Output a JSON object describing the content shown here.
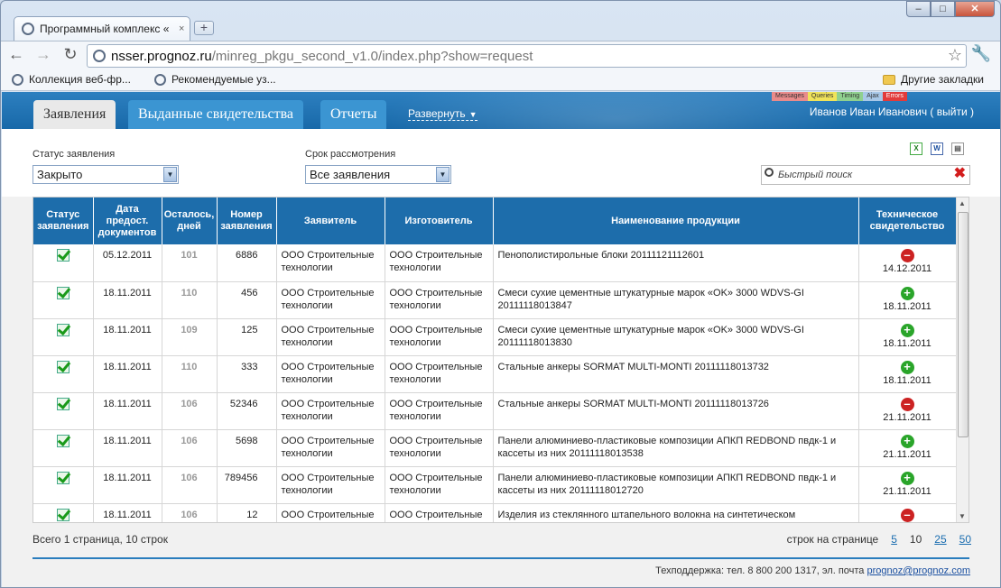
{
  "browser": {
    "tab_title": "Программный комплекс «",
    "tab_close": "×",
    "new_tab": "+",
    "url_host": "nsser.prognoz.ru",
    "url_path": "/minreg_pkgu_second_v1.0/index.php?show=request",
    "bookmarks": [
      "Коллекция веб-фр...",
      "Рекомендуемые уз..."
    ],
    "other_bookmarks": "Другие закладки"
  },
  "app": {
    "tabs": [
      "Заявления",
      "Выданные свидетельства",
      "Отчеты"
    ],
    "expand": "Развернуть",
    "debug": [
      "Messages",
      "Queries",
      "Timing",
      "Ajax",
      "Errors"
    ],
    "user": "Иванов Иван Иванович ( выйти )"
  },
  "filters": {
    "status_label": "Статус заявления",
    "status_value": "Закрыто",
    "term_label": "Срок рассмотрения",
    "term_value": "Все заявления",
    "search_placeholder": "Быстрый поиск"
  },
  "table": {
    "headers": [
      "Статус заявления",
      "Дата предост. документов",
      "Осталось, дней",
      "Номер заявления",
      "Заявитель",
      "Изготовитель",
      "Наименование продукции",
      "Техническое свидетельство"
    ],
    "rows": [
      {
        "date": "05.12.2011",
        "days": "101",
        "number": "6886",
        "applicant": "ООО Строительные технологии",
        "maker": "ООО Строительные технологии",
        "product": "Пенополистирольные блоки 20111121112601",
        "cert": "minus",
        "cert_date": "14.12.2011"
      },
      {
        "date": "18.11.2011",
        "days": "110",
        "number": "456",
        "applicant": "ООО Строительные технологии",
        "maker": "ООО Строительные технологии",
        "product": "Смеси сухие цементные штукатурные марок «OK» 3000 WDVS-GI 20111118013847",
        "cert": "plus",
        "cert_date": "18.11.2011"
      },
      {
        "date": "18.11.2011",
        "days": "109",
        "number": "125",
        "applicant": "ООО Строительные технологии",
        "maker": "ООО Строительные технологии",
        "product": "Смеси сухие цементные штукатурные марок «OK» 3000 WDVS-GI 20111118013830",
        "cert": "plus",
        "cert_date": "18.11.2011"
      },
      {
        "date": "18.11.2011",
        "days": "110",
        "number": "333",
        "applicant": "ООО Строительные технологии",
        "maker": "ООО Строительные технологии",
        "product": "Стальные анкеры SORMAT MULTI-MONTI 20111118013732",
        "cert": "plus",
        "cert_date": "18.11.2011"
      },
      {
        "date": "18.11.2011",
        "days": "106",
        "number": "52346",
        "applicant": "ООО Строительные технологии",
        "maker": "ООО Строительные технологии",
        "product": "Стальные анкеры SORMAT MULTI-MONTI 20111118013726",
        "cert": "minus",
        "cert_date": "21.11.2011"
      },
      {
        "date": "18.11.2011",
        "days": "106",
        "number": "5698",
        "applicant": "ООО Строительные технологии",
        "maker": "ООО Строительные технологии",
        "product": "Панели алюминиево-пластиковые композиции АПКП REDBOND пвдк-1 и кассеты из них 20111118013538",
        "cert": "plus",
        "cert_date": "21.11.2011"
      },
      {
        "date": "18.11.2011",
        "days": "106",
        "number": "789456",
        "applicant": "ООО Строительные технологии",
        "maker": "ООО Строительные технологии",
        "product": "Панели алюминиево-пластиковые композиции АПКП REDBOND пвдк-1 и кассеты из них 20111118012720",
        "cert": "plus",
        "cert_date": "21.11.2011"
      },
      {
        "date": "18.11.2011",
        "days": "106",
        "number": "12",
        "applicant": "ООО Строительные",
        "maker": "ООО Строительные",
        "product": "Изделия из стеклянного штапельного волокна на синтетическом",
        "cert": "minus",
        "cert_date": ""
      }
    ]
  },
  "footer": {
    "summary": "Всего 1 страница, 10 строк",
    "per_page_label": "строк на странице",
    "page_sizes": [
      "5",
      "10",
      "25",
      "50"
    ],
    "support_text": "Техподдержка: тел. 8 800 200 1317, эл. почта",
    "support_email": "prognoz@prognoz.com"
  },
  "colors": {
    "header_blue": "#1d6dab",
    "link": "#1a6db0",
    "ok": "#2aa52a",
    "stop": "#c22"
  }
}
